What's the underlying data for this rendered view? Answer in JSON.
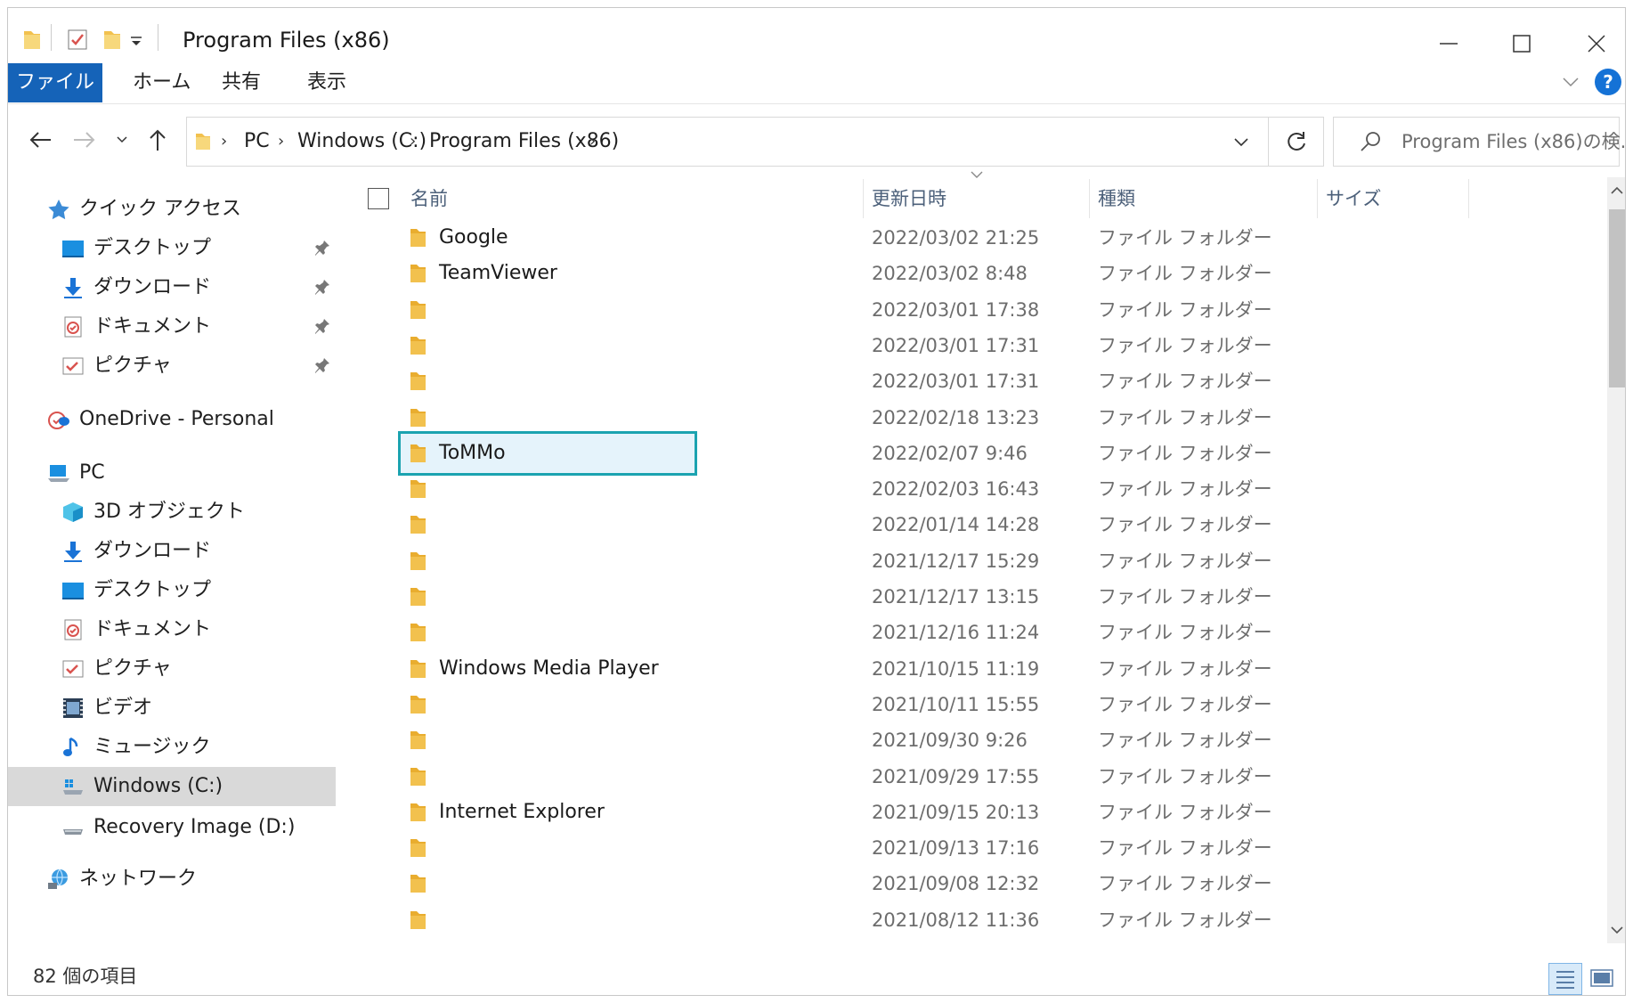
{
  "window": {
    "title": "Program Files (x86)"
  },
  "ribbon": {
    "tabs": [
      "ファイル",
      "ホーム",
      "共有",
      "表示"
    ],
    "help": "?"
  },
  "address": {
    "crumbs": [
      "PC",
      "Windows (C:)",
      "Program Files (x86)"
    ],
    "search_placeholder": "Program Files (x86)の検..."
  },
  "sidebar": {
    "quick_access": "クイック アクセス",
    "quick_items": [
      "デスクトップ",
      "ダウンロード",
      "ドキュメント",
      "ピクチャ"
    ],
    "onedrive": "OneDrive - Personal",
    "pc": "PC",
    "pc_items": [
      "3D オブジェクト",
      "ダウンロード",
      "デスクトップ",
      "ドキュメント",
      "ピクチャ",
      "ビデオ",
      "ミュージック",
      "Windows (C:)",
      "Recovery Image (D:)"
    ],
    "network": "ネットワーク"
  },
  "columns": {
    "name": "名前",
    "date": "更新日時",
    "type": "種類",
    "size": "サイズ"
  },
  "rows": [
    {
      "name": "Google",
      "date": "2022/03/02 21:25",
      "type": "ファイル フォルダー"
    },
    {
      "name": "TeamViewer",
      "date": "2022/03/02 8:48",
      "type": "ファイル フォルダー"
    },
    {
      "name": "",
      "date": "2022/03/01 17:38",
      "type": "ファイル フォルダー"
    },
    {
      "name": "",
      "date": "2022/03/01 17:31",
      "type": "ファイル フォルダー"
    },
    {
      "name": "",
      "date": "2022/03/01 17:31",
      "type": "ファイル フォルダー"
    },
    {
      "name": "",
      "date": "2022/02/18 13:23",
      "type": "ファイル フォルダー"
    },
    {
      "name": "ToMMo",
      "date": "2022/02/07 9:46",
      "type": "ファイル フォルダー"
    },
    {
      "name": "",
      "date": "2022/02/03 16:43",
      "type": "ファイル フォルダー"
    },
    {
      "name": "",
      "date": "2022/01/14 14:28",
      "type": "ファイル フォルダー"
    },
    {
      "name": "",
      "date": "2021/12/17 15:29",
      "type": "ファイル フォルダー"
    },
    {
      "name": "",
      "date": "2021/12/17 13:15",
      "type": "ファイル フォルダー"
    },
    {
      "name": "",
      "date": "2021/12/16 11:24",
      "type": "ファイル フォルダー"
    },
    {
      "name": "Windows Media Player",
      "date": "2021/10/15 11:19",
      "type": "ファイル フォルダー"
    },
    {
      "name": "",
      "date": "2021/10/11 15:55",
      "type": "ファイル フォルダー"
    },
    {
      "name": "",
      "date": "2021/09/30 9:26",
      "type": "ファイル フォルダー"
    },
    {
      "name": "",
      "date": "2021/09/29 17:55",
      "type": "ファイル フォルダー"
    },
    {
      "name": "Internet Explorer",
      "date": "2021/09/15 20:13",
      "type": "ファイル フォルダー"
    },
    {
      "name": "",
      "date": "2021/09/13 17:16",
      "type": "ファイル フォルダー"
    },
    {
      "name": "",
      "date": "2021/09/08 12:32",
      "type": "ファイル フォルダー"
    },
    {
      "name": "",
      "date": "2021/08/12 11:36",
      "type": "ファイル フォルダー"
    }
  ],
  "status": {
    "item_count": "82 個の項目"
  },
  "colors": {
    "file_tab": "#1563b8",
    "highlight_border": "#1ba3b0",
    "folder": "#f2c14e"
  }
}
